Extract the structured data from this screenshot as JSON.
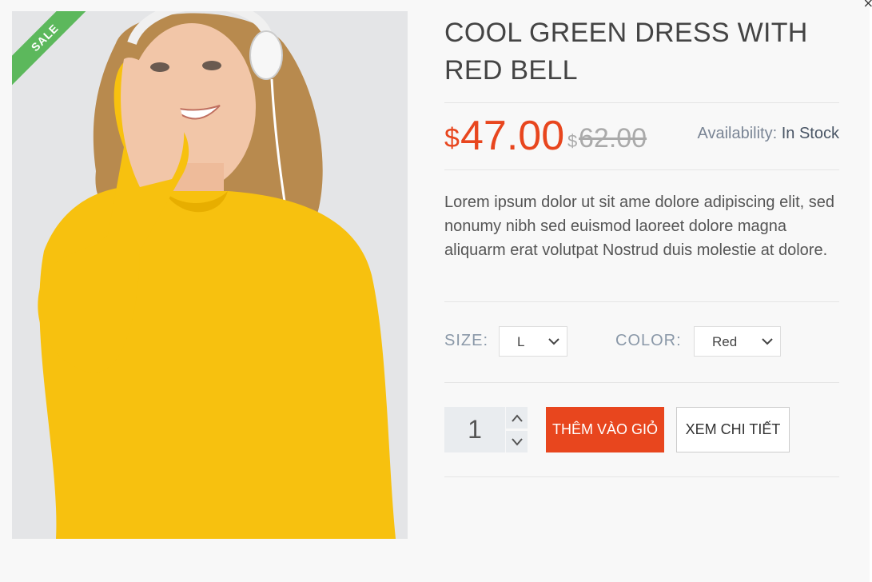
{
  "product": {
    "badge": "SALE",
    "title": "COOL GREEN DRESS WITH RED BELL",
    "price_currency": "$",
    "price": "47.00",
    "old_price_currency": "$",
    "old_price": "62.00",
    "availability_label": "Availability:",
    "availability_value": "In Stock",
    "description": "Lorem ipsum dolor ut sit ame dolore adipiscing elit, sed nonumy nibh sed euismod laoreet dolore magna aliquarm erat volutpat Nostrud duis molestie at dolore."
  },
  "options": {
    "size_label": "SIZE:",
    "size_value": "L",
    "color_label": "COLOR:",
    "color_value": "Red"
  },
  "cart": {
    "quantity": "1",
    "add_to_cart_label": "THÊM VÀO GIỎ",
    "view_detail_label": "XEM CHI TIẾT"
  },
  "colors": {
    "accent": "#e8461e",
    "sale_badge": "#5cb85c",
    "old_price": "#aaaaaa"
  },
  "icons": [
    "close-icon",
    "chevron-down-icon",
    "chevron-up-icon"
  ]
}
